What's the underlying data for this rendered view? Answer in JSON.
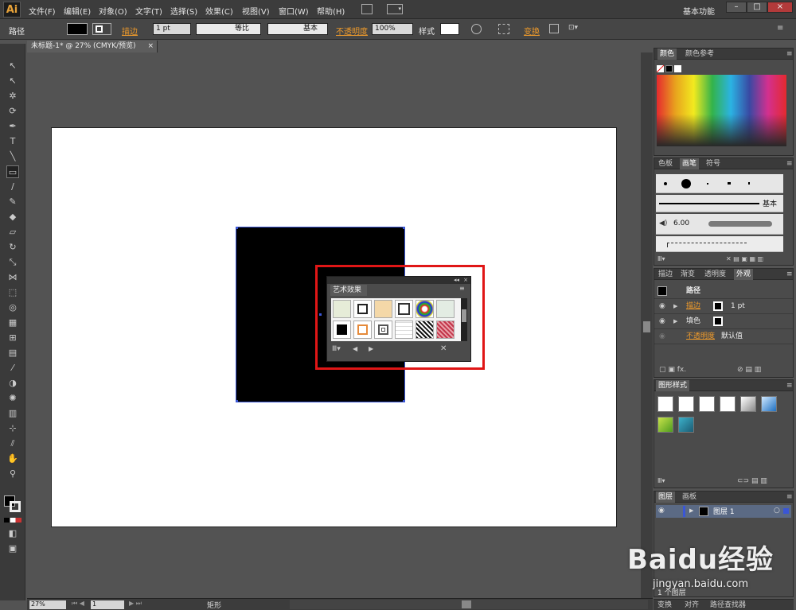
{
  "app": {
    "logo": "Ai",
    "workspace": "基本功能"
  },
  "menu": [
    "文件(F)",
    "编辑(E)",
    "对象(O)",
    "文字(T)",
    "选择(S)",
    "效果(C)",
    "视图(V)",
    "窗口(W)",
    "帮助(H)"
  ],
  "control": {
    "object_type": "路径",
    "stroke_label": "描边",
    "stroke_weight": "1 pt",
    "profile": "等比",
    "brush": "基本",
    "opacity_label": "不透明度",
    "opacity_value": "100%",
    "style_label": "样式",
    "transform_label": "变换"
  },
  "document": {
    "tab_title": "未标题-1* @ 27% (CMYK/预览)",
    "tab_close": "×"
  },
  "art_panel": {
    "title": "艺术效果",
    "menu": "≡"
  },
  "panels": {
    "color": {
      "tabs": [
        "颜色",
        "颜色参考"
      ]
    },
    "brushes": {
      "tabs": [
        "色板",
        "画笔",
        "符号"
      ],
      "basic_label": "基本",
      "size_value": "6.00"
    },
    "appearance": {
      "tabs": [
        "描边",
        "渐变",
        "透明度",
        "外观"
      ],
      "object_label": "路径",
      "stroke_label": "描边",
      "stroke_value": "1 pt",
      "fill_label": "填色",
      "opacity_label": "不透明度",
      "opacity_value": "默认值"
    },
    "graphic_styles": {
      "tabs": [
        "图形样式"
      ]
    },
    "layers": {
      "tabs": [
        "图层",
        "画板"
      ],
      "layer_name": "图层 1",
      "layer_count": "1 个图层"
    },
    "bottom_tabs": [
      "变换",
      "对齐",
      "路径查找器"
    ]
  },
  "status": {
    "zoom": "27%",
    "page": "1",
    "tool_name": "矩形"
  },
  "watermark": {
    "brand": "Baidu经验",
    "url": "jingyan.baidu.com"
  },
  "colors": {
    "highlight": "#e01616",
    "selection": "#3a56d6",
    "accent_orange": "#ee9a2b"
  }
}
